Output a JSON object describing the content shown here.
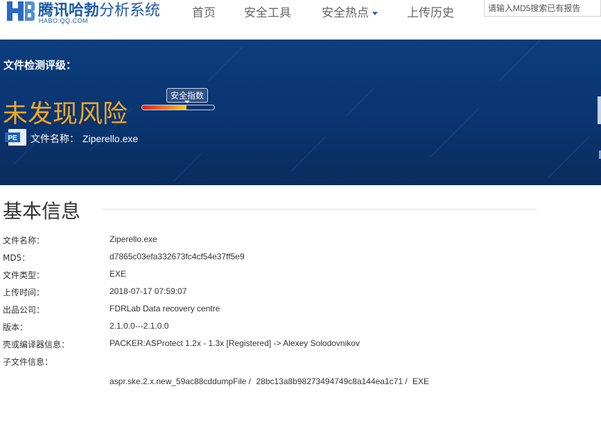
{
  "header": {
    "logo_title_bold": "腾讯哈勃",
    "logo_title_light": "分析系统",
    "logo_sub": "HABO.QQ.COM",
    "nav": [
      {
        "label": "首页"
      },
      {
        "label": "安全工具"
      },
      {
        "label": "安全热点",
        "has_dropdown": true
      },
      {
        "label": "上传历史"
      }
    ],
    "search": {
      "placeholder": "请输入MD5搜索已有报告",
      "value": ""
    }
  },
  "banner": {
    "label": "文件检测评级：",
    "risk_title": "未发现风险",
    "index_tag": "安全指数",
    "index_level": 0.62,
    "pe_icon_text": "PE",
    "file_label": "文件名称：",
    "file_name": "Ziperello.exe"
  },
  "basic_info": {
    "title": "基本信息",
    "rows": [
      {
        "key": "文件名称：",
        "value": "Ziperello.exe"
      },
      {
        "key": "MD5：",
        "value": "d7865c03efa332673fc4cf54e37ff5e9"
      },
      {
        "key": "文件类型：",
        "value": "EXE"
      },
      {
        "key": "上传时间：",
        "value": "2018-07-17 07:59:07"
      },
      {
        "key": "出品公司：",
        "value": "FDRLab Data recovery centre"
      },
      {
        "key": "版本：",
        "value": "2.1.0.0---2.1.0.0"
      },
      {
        "key": "壳或编译器信息：",
        "value": "PACKER:ASProtect 1.2x - 1.3x [Registered] -> Alexey Solodovnikov"
      },
      {
        "key": "子文件信息：",
        "value": ""
      }
    ],
    "sub_file": {
      "name": "aspr.ske.2.x.new_59ac88cddumpFile /",
      "hash": "28bc13a8b98273494749c8a144ea1c71 /",
      "type": "EXE"
    }
  },
  "colors": {
    "brand_blue": "#1d5aa8",
    "banner_bg": "#0a3570",
    "risk_orange": "#f5a623"
  }
}
